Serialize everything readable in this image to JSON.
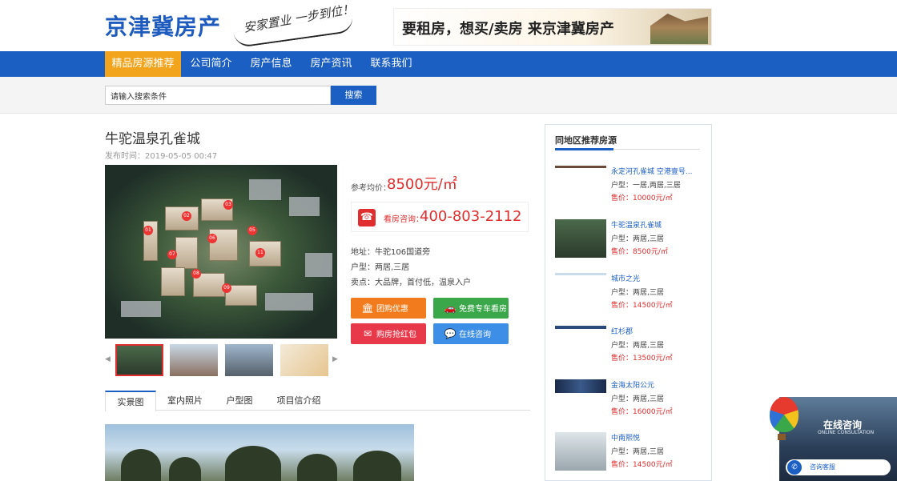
{
  "header": {
    "logo": "京津冀房产",
    "slogan": "安家置业 一步到位！",
    "banner": "要租房，想买/卖房 来京津冀房产"
  },
  "nav": {
    "items": [
      "精品房源推荐",
      "公司简介",
      "房产信息",
      "房产资讯",
      "联系我们"
    ],
    "active": "精品房源推荐"
  },
  "search": {
    "placeholder": "请输入搜索条件",
    "button": "搜索"
  },
  "property": {
    "title": "牛驼温泉孔雀城",
    "pubtime": "发布时间：2019-05-05 00:47",
    "price_label": "参考均价：",
    "price_value": "8500元/㎡",
    "phone_label": "看房咨询：",
    "phone": "400-803-2112",
    "address": "地址：牛驼106国道旁",
    "type": "户型：两居,三居",
    "selling": "卖点：大品牌，首付低，温泉入户",
    "actions": [
      "团购优惠",
      "免费专车看房",
      "购房抢红包",
      "在线咨询"
    ]
  },
  "thumbs": {
    "prev": "◀",
    "next": "▶"
  },
  "tabs": [
    "实景图",
    "室内照片",
    "户型图",
    "项目信介绍"
  ],
  "sidebar": {
    "title": "同地区推荐房源",
    "items": [
      {
        "name": "永定河孔雀城 空港壹号...",
        "type": "户型：一居,两居,三居",
        "price": "售价：10000元/㎡"
      },
      {
        "name": "牛驼温泉孔雀城",
        "type": "户型：两居,三居",
        "price": "售价：8500元/㎡"
      },
      {
        "name": "城市之光",
        "type": "户型：两居,三居",
        "price": "售价：14500元/㎡"
      },
      {
        "name": "红杉郡",
        "type": "户型：两居,三居",
        "price": "售价：13500元/㎡"
      },
      {
        "name": "金海太阳公元",
        "type": "户型：两居,三居",
        "price": "售价：16000元/㎡"
      },
      {
        "name": "中南熙悦",
        "type": "户型：两居,三居",
        "price": "售价：14500元/㎡"
      }
    ]
  },
  "float_consult": {
    "title": "在线咨询",
    "subtitle": "ONLINE CONSULTATION",
    "button": "咨询客服"
  },
  "colors": {
    "brand_blue": "#1c5fc3",
    "accent_orange": "#f3a41d",
    "price_red": "#e02d2d",
    "btn_orange": "#f27c1d",
    "btn_green": "#3aa84a",
    "btn_red": "#e8394a",
    "btn_blue": "#3c8ee6"
  }
}
